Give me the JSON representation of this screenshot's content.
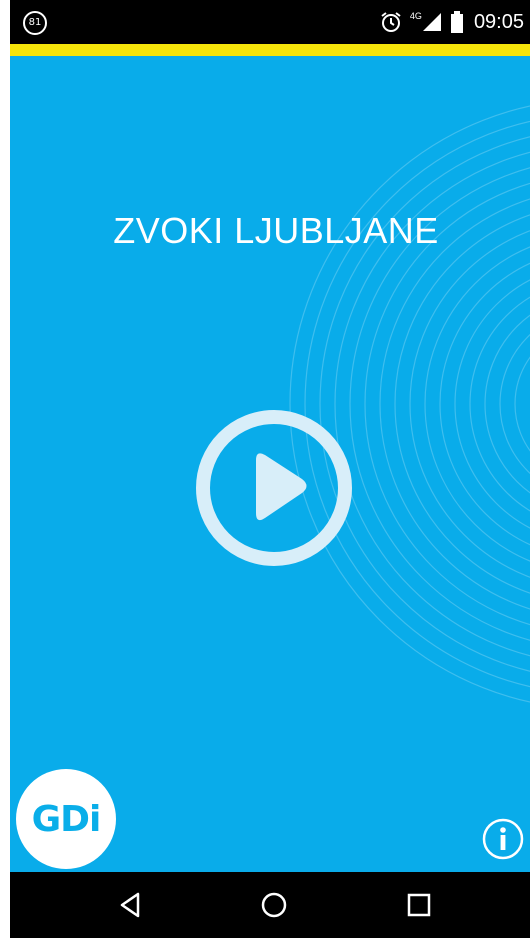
{
  "status_bar": {
    "notification_badge": "81",
    "network_type": "4G",
    "time": "09:05",
    "icons": [
      "notification-count-icon",
      "alarm-icon",
      "signal-icon",
      "battery-icon"
    ]
  },
  "colors": {
    "background": "#09acea",
    "accent_strip": "#f5e40a",
    "status_bar": "#000000",
    "nav_bar": "#000000"
  },
  "main": {
    "title": "ZVOKI LJUBLJANE",
    "play_icon": "play-icon",
    "logo_text": "GDi",
    "info_icon": "info-icon"
  },
  "nav": {
    "icons": [
      "back-icon",
      "home-icon",
      "recents-icon"
    ]
  }
}
